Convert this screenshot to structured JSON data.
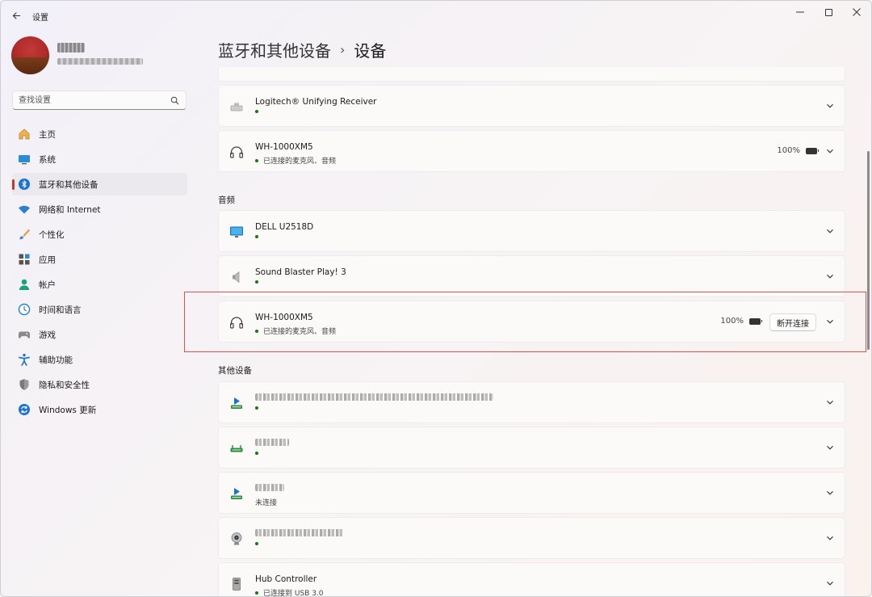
{
  "window": {
    "title": "设置",
    "controls": {
      "minimize": "—",
      "maximize": "",
      "close": "✕"
    }
  },
  "sidebar": {
    "user": {
      "name": "",
      "email": ""
    },
    "search": {
      "placeholder": "查找设置"
    },
    "items": [
      {
        "label": "主页",
        "icon": "home-icon"
      },
      {
        "label": "系统",
        "icon": "system-icon"
      },
      {
        "label": "蓝牙和其他设备",
        "icon": "bluetooth-icon",
        "active": true
      },
      {
        "label": "网络和 Internet",
        "icon": "wifi-icon"
      },
      {
        "label": "个性化",
        "icon": "brush-icon"
      },
      {
        "label": "应用",
        "icon": "apps-icon"
      },
      {
        "label": "帐户",
        "icon": "account-icon"
      },
      {
        "label": "时间和语言",
        "icon": "time-language-icon"
      },
      {
        "label": "游戏",
        "icon": "gaming-icon"
      },
      {
        "label": "辅助功能",
        "icon": "accessibility-icon"
      },
      {
        "label": "隐私和安全性",
        "icon": "shield-icon"
      },
      {
        "label": "Windows 更新",
        "icon": "update-icon"
      }
    ]
  },
  "breadcrumb": {
    "parent": "蓝牙和其他设备",
    "separator": "›",
    "current": "设备"
  },
  "input_section": {
    "devices": [
      {
        "name": "Logitech® Unifying Receiver",
        "status": "",
        "icon": "receiver-icon"
      },
      {
        "name": "WH-1000XM5",
        "status": "已连接的麦克风、音频",
        "battery": "100%",
        "icon": "headphones-icon"
      }
    ]
  },
  "audio_section": {
    "title": "音频",
    "devices": [
      {
        "name": "DELL U2518D",
        "status": "",
        "icon": "monitor-icon"
      },
      {
        "name": "Sound Blaster Play! 3",
        "status": "",
        "icon": "speaker-icon"
      },
      {
        "name": "WH-1000XM5",
        "status": "已连接的麦克风、音频",
        "battery": "100%",
        "button": "断开连接",
        "icon": "headphones-icon"
      }
    ]
  },
  "other_section": {
    "title": "其他设备",
    "devices": [
      {
        "name": "",
        "status": "",
        "icon": "media-device-icon"
      },
      {
        "name": "",
        "status": "",
        "icon": "router-icon"
      },
      {
        "name": "",
        "status": "未连接",
        "icon": "media-device-icon"
      },
      {
        "name": "",
        "status": "",
        "icon": "webcam-icon"
      },
      {
        "name": "Hub Controller",
        "status": "已连接到 USB 3.0",
        "icon": "usb-hub-icon"
      }
    ]
  },
  "colors": {
    "accent": "#c0392b",
    "status_connected": "#107c10",
    "highlight_border": "#d9534f"
  }
}
